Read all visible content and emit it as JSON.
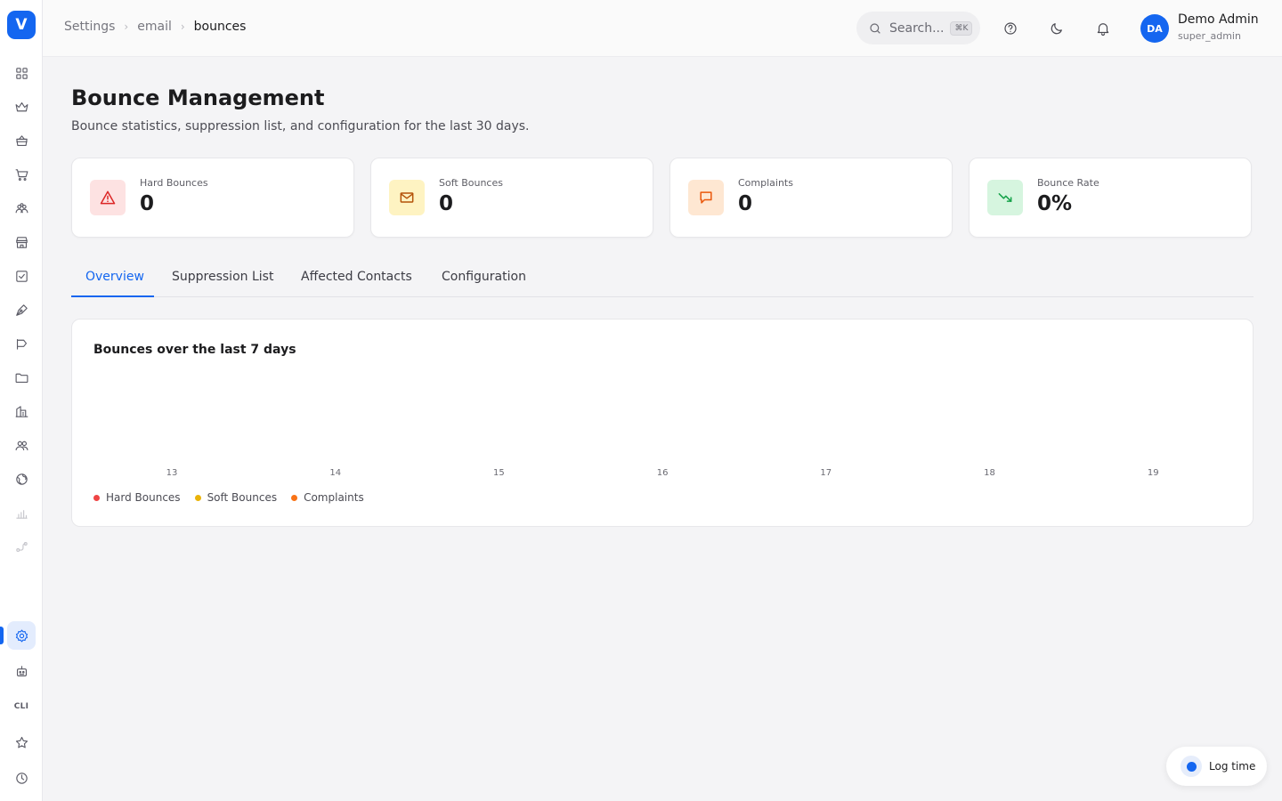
{
  "app": {
    "logo_letter": "V"
  },
  "breadcrumb": [
    "Settings",
    "email",
    "bounces"
  ],
  "search": {
    "placeholder": "Search...",
    "shortcut": "⌘K"
  },
  "header_icons": [
    "help-icon",
    "moon-icon",
    "bell-icon"
  ],
  "user": {
    "initials": "DA",
    "name": "Demo Admin",
    "role": "super_admin"
  },
  "sidebar": {
    "items": [
      "dashboard-grid-icon",
      "crown-icon",
      "basket-icon",
      "cart-icon",
      "users-group-icon",
      "store-icon",
      "checkbox-icon",
      "pen-nib-icon",
      "megaphone-icon",
      "folder-icon",
      "buildings-icon",
      "contacts-icon",
      "globe-icon",
      "bar-chart-icon",
      "route-icon",
      "settings-gear-icon",
      "robot-icon",
      "cli-icon",
      "star-icon",
      "clock-icon"
    ],
    "cli_label": "CLI",
    "active": "settings-gear-icon"
  },
  "page": {
    "title": "Bounce Management",
    "subtitle": "Bounce statistics, suppression list, and configuration for the last 30 days."
  },
  "stats": [
    {
      "label": "Hard Bounces",
      "value": "0",
      "icon": "alert-triangle-icon",
      "color": "#dc2626",
      "bg": "#fde2e2"
    },
    {
      "label": "Soft Bounces",
      "value": "0",
      "icon": "mail-icon",
      "color": "#b45309",
      "bg": "#fef3c2"
    },
    {
      "label": "Complaints",
      "value": "0",
      "icon": "message-square-icon",
      "color": "#ea580c",
      "bg": "#fee7d2"
    },
    {
      "label": "Bounce Rate",
      "value": "0%",
      "icon": "trending-down-icon",
      "color": "#16a34a",
      "bg": "#d6f5df"
    }
  ],
  "tabs": [
    "Overview",
    "Suppression List",
    "Affected Contacts",
    "Configuration"
  ],
  "active_tab": "Overview",
  "chart_data": {
    "type": "line",
    "title": "Bounces over the last 7 days",
    "categories": [
      "13",
      "14",
      "15",
      "16",
      "17",
      "18",
      "19"
    ],
    "series": [
      {
        "name": "Hard Bounces",
        "color": "#ef4444",
        "values": [
          0,
          0,
          0,
          0,
          0,
          0,
          0
        ]
      },
      {
        "name": "Soft Bounces",
        "color": "#eab308",
        "values": [
          0,
          0,
          0,
          0,
          0,
          0,
          0
        ]
      },
      {
        "name": "Complaints",
        "color": "#f97316",
        "values": [
          0,
          0,
          0,
          0,
          0,
          0,
          0
        ]
      }
    ],
    "legend_position": "bottom-left",
    "grid": false
  },
  "log_time": {
    "label": "Log time"
  }
}
